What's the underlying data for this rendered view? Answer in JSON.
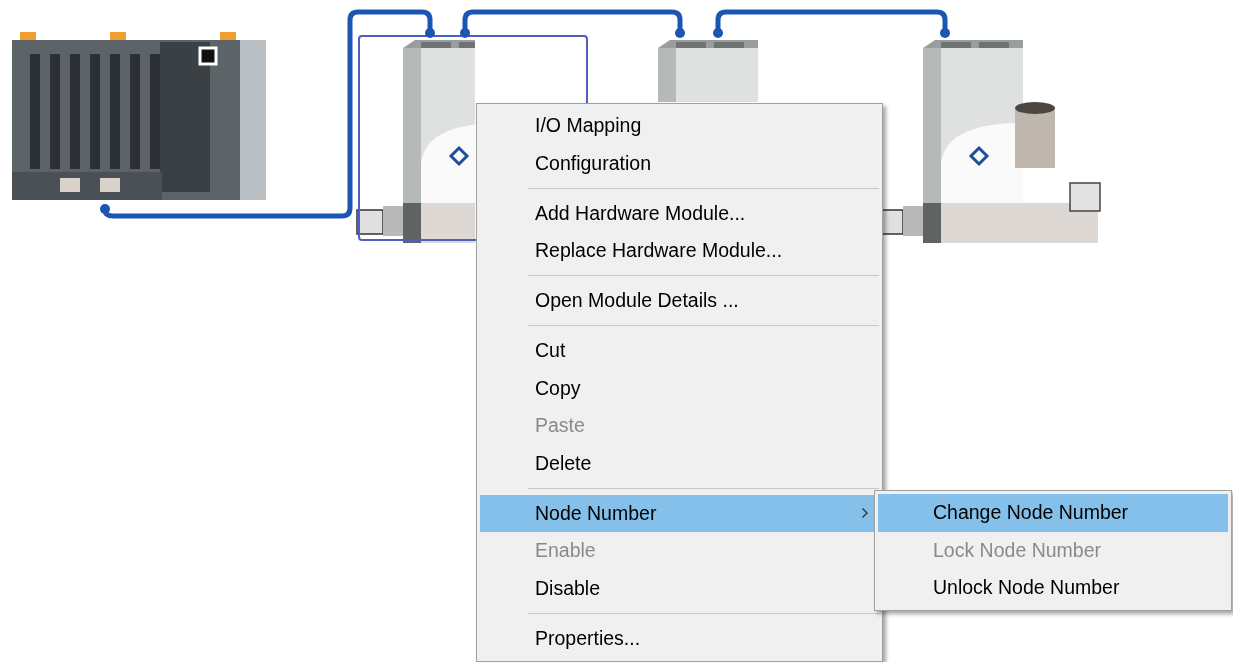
{
  "devices": [
    {
      "kind": "controller",
      "selected": false
    },
    {
      "kind": "flow_meter",
      "selected": true
    },
    {
      "kind": "flow_meter",
      "selected": false
    },
    {
      "kind": "flow_controller",
      "selected": false
    }
  ],
  "context_menu": {
    "items": [
      {
        "kind": "item",
        "label": "I/O Mapping",
        "disabled": false,
        "selected": false
      },
      {
        "kind": "item",
        "label": "Configuration",
        "disabled": false,
        "selected": false
      },
      {
        "kind": "separator"
      },
      {
        "kind": "item",
        "label": "Add Hardware Module...",
        "disabled": false,
        "selected": false
      },
      {
        "kind": "item",
        "label": "Replace Hardware Module...",
        "disabled": false,
        "selected": false
      },
      {
        "kind": "separator"
      },
      {
        "kind": "item",
        "label": "Open Module Details ...",
        "disabled": false,
        "selected": false
      },
      {
        "kind": "separator"
      },
      {
        "kind": "item",
        "label": "Cut",
        "disabled": false,
        "selected": false
      },
      {
        "kind": "item",
        "label": "Copy",
        "disabled": false,
        "selected": false
      },
      {
        "kind": "item",
        "label": "Paste",
        "disabled": true,
        "selected": false
      },
      {
        "kind": "item",
        "label": "Delete",
        "disabled": false,
        "selected": false
      },
      {
        "kind": "separator"
      },
      {
        "kind": "submenu",
        "label": "Node Number",
        "disabled": false,
        "selected": true
      },
      {
        "kind": "item",
        "label": "Enable",
        "disabled": true,
        "selected": false
      },
      {
        "kind": "item",
        "label": "Disable",
        "disabled": false,
        "selected": false
      },
      {
        "kind": "separator"
      },
      {
        "kind": "item",
        "label": "Properties...",
        "disabled": false,
        "selected": false
      }
    ]
  },
  "submenu": {
    "items": [
      {
        "kind": "item",
        "label": "Change Node Number",
        "disabled": false,
        "selected": true
      },
      {
        "kind": "item",
        "label": "Lock Node Number",
        "disabled": true,
        "selected": false
      },
      {
        "kind": "item",
        "label": "Unlock Node Number",
        "disabled": false,
        "selected": false
      }
    ]
  }
}
